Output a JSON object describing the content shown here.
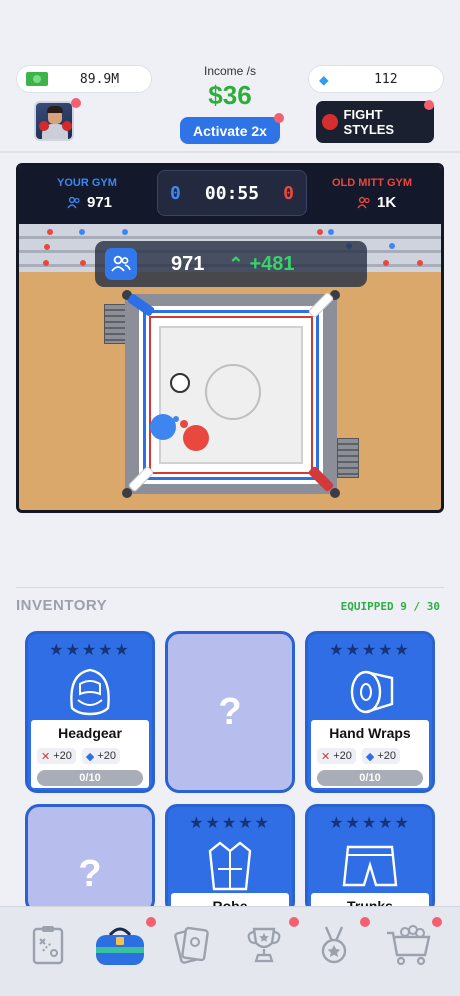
{
  "hud": {
    "cash": "89.9M",
    "gems": "112",
    "income_label": "Income /s",
    "income_value": "$36",
    "activate_label": "Activate 2x",
    "fight_styles_label": "FIGHT STYLES",
    "cash_icon": "cash-icon",
    "gem_icon": "gem-icon"
  },
  "match": {
    "home_label": "YOUR GYM",
    "home_count": "971",
    "away_label": "OLD MITT GYM",
    "away_count": "1K",
    "home_score": "0",
    "away_score": "0",
    "timer": "00:55",
    "attendance": "971",
    "attendance_gain": "+481"
  },
  "inventory": {
    "title": "INVENTORY",
    "equipped": "EQUIPPED 9 / 30",
    "cards": [
      {
        "name": "Headgear",
        "stars": "★★★★★",
        "attack": "+20",
        "defense": "+20",
        "level": "0/10"
      },
      {
        "empty": "?"
      },
      {
        "name": "Hand Wraps",
        "stars": "★★★★★",
        "attack": "+20",
        "defense": "+20",
        "level": "0/10"
      },
      {
        "empty": "?"
      },
      {
        "name": "Robe",
        "stars": "★★★★★"
      },
      {
        "name": "Trunks",
        "stars": "★★★★★"
      }
    ]
  },
  "nav": [
    "strategy-board-icon",
    "gym-bag-icon",
    "cards-icon",
    "trophy-icon",
    "medal-icon",
    "shop-cart-icon"
  ],
  "colors": {
    "home": "#3d86f2",
    "away": "#e8483e",
    "income": "#2cae3c",
    "card": "#2f6ee4"
  }
}
